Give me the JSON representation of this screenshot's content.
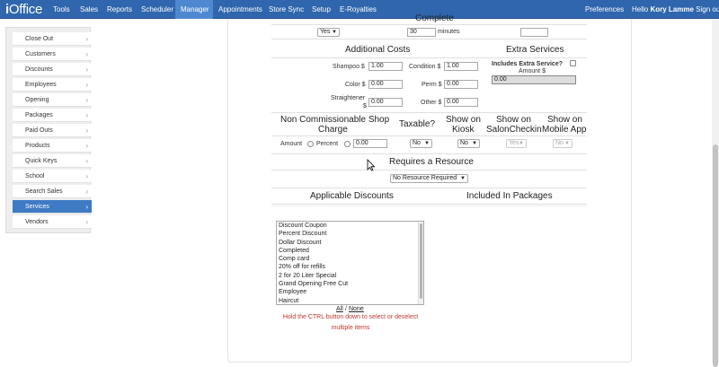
{
  "brand": {
    "prefix": "i",
    "name": "Office"
  },
  "nav": [
    "Tools",
    "Sales",
    "Reports",
    "Scheduler",
    "Manager",
    "Appointments",
    "Store Sync",
    "Setup",
    "E-Royalties"
  ],
  "nav_right": {
    "preferences": "Preferences",
    "hello": "Hello",
    "user": "Kory Lamme",
    "signout": "Sign out"
  },
  "sidebar": [
    "Close Out",
    "Customers",
    "Discounts",
    "Employees",
    "Opening",
    "Packages",
    "Paid Outs",
    "Products",
    "Quick Keys",
    "School",
    "Search Sales",
    "Services",
    "Vendors"
  ],
  "form": {
    "complete_heading": "Complete",
    "complete_select": "Yes",
    "minutes_value": "30",
    "minutes_label": "minutes",
    "top_right_value": "",
    "additional_costs": "Additional Costs",
    "extra_services": "Extra Services",
    "shampoo_label": "Shampoo $",
    "shampoo_value": "1.00",
    "condition_label": "Condition $",
    "condition_value": "1.00",
    "color_label": "Color $",
    "color_value": "0.00",
    "perm_label": "Perm $",
    "perm_value": "0.00",
    "straightener_label_1": "Straightener",
    "straightener_label_2": "$",
    "straightener_value": "0.00",
    "other_label": "Other $",
    "other_value": "0.00",
    "includes_extra": "Includes Extra Service?",
    "amount_label": "Amount $",
    "amount_value": "0.00",
    "ncsc_1": "Non Commissionable Shop",
    "ncsc_2": "Charge",
    "taxable": "Taxable?",
    "kiosk_1": "Show on",
    "kiosk_2": "Kiosk",
    "salon_1": "Show on",
    "salon_2": "SalonCheckin",
    "mobile_1": "Show on",
    "mobile_2": "Mobile App",
    "amount_radio": "Amount",
    "percent_radio": "Percent",
    "charge_value": "0.00",
    "taxable_select": "No",
    "kiosk_select": "No",
    "salon_select": "Yes",
    "mobile_select": "No",
    "requires_resource": "Requires a Resource",
    "resource_select": "No Resource Required",
    "applicable_discounts": "Applicable Discounts",
    "included_packages": "Included In Packages",
    "discounts": [
      "Discount Coupon",
      "Percent Discount",
      "Dollar Discount",
      "Completed",
      "Comp card",
      "20% off for refills",
      "2 for 20 Liter Special",
      "Grand Opening Free Cut",
      "Employee",
      "Haircut"
    ],
    "all_link": "All",
    "slash": "/",
    "none_link": "None",
    "ctrl_hint_1": "Hold the CTRL button down to select or deselect",
    "ctrl_hint_2": "multiple items"
  }
}
